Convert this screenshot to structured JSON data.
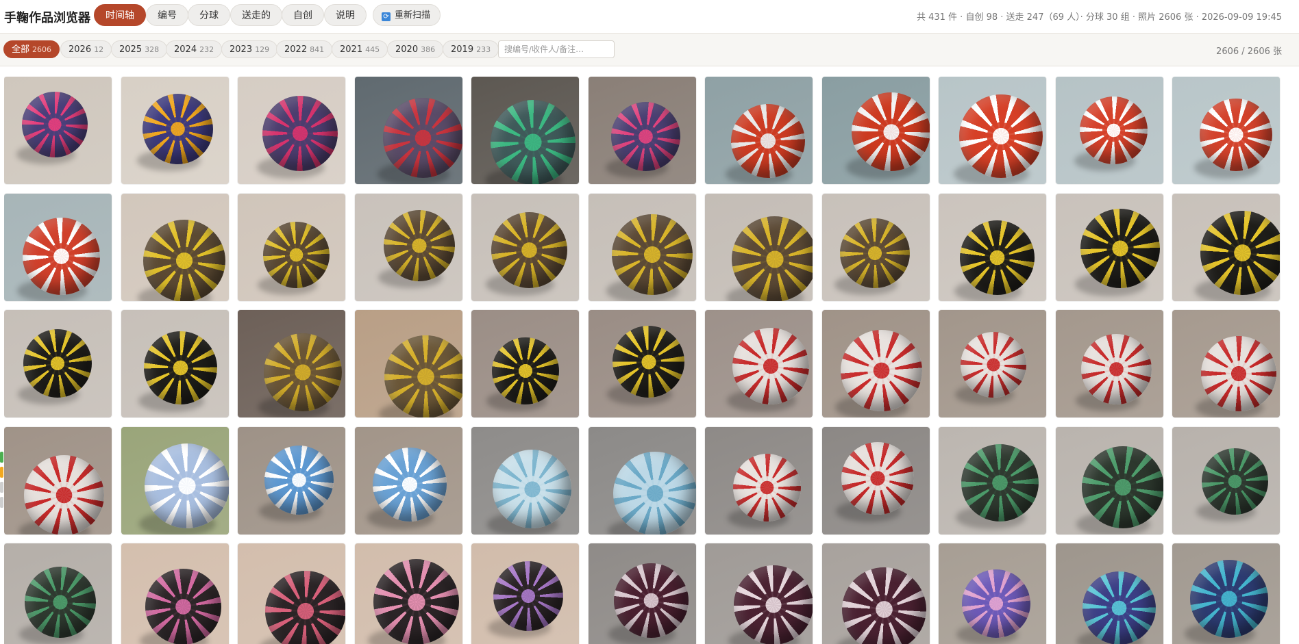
{
  "app": {
    "title": "手鞠作品浏览器",
    "tabs": [
      {
        "label": "时间轴",
        "active": true
      },
      {
        "label": "编号",
        "active": false
      },
      {
        "label": "分球",
        "active": false
      },
      {
        "label": "送走的",
        "active": false
      },
      {
        "label": "自创",
        "active": false
      },
      {
        "label": "说明",
        "active": false
      }
    ],
    "rescan_label": "重新扫描",
    "rescan_icon": "refresh-icon",
    "stats": "共 431 件 · 自创 98 · 送走 247（69 人）· 分球 30 组 · 照片 2606 张 · 2026-09-09 19:45"
  },
  "filters": {
    "years": [
      {
        "label": "全部",
        "count": "2606",
        "active": true
      },
      {
        "label": "2026",
        "count": "12",
        "active": false
      },
      {
        "label": "2025",
        "count": "328",
        "active": false
      },
      {
        "label": "2024",
        "count": "232",
        "active": false
      },
      {
        "label": "2023",
        "count": "129",
        "active": false
      },
      {
        "label": "2022",
        "count": "841",
        "active": false
      },
      {
        "label": "2021",
        "count": "445",
        "active": false
      },
      {
        "label": "2020",
        "count": "386",
        "active": false
      },
      {
        "label": "2019",
        "count": "233",
        "active": false
      }
    ],
    "search_placeholder": "搜编号/收件人/备注…",
    "search_value": "",
    "pager": "2606 / 2606 张"
  },
  "colors": {
    "accent": "#b5472a",
    "chip_bg": "#efeeec",
    "page_bg": "#ffffff"
  },
  "photos": [
    {
      "bg": "#cfc7bd",
      "ball": "#4a3f7a",
      "accent": "#e53e7c"
    },
    {
      "bg": "#d8d0c6",
      "ball": "#3d3a7e",
      "accent": "#f2a81e"
    },
    {
      "bg": "#d6cdc4",
      "ball": "#4c3d6e",
      "accent": "#d7336d"
    },
    {
      "bg": "#606a70",
      "ball": "#5a4b68",
      "accent": "#c9343e"
    },
    {
      "bg": "#5d5852",
      "ball": "#3f5a5a",
      "accent": "#3cb882"
    },
    {
      "bg": "#8a7f77",
      "ball": "#4a3f72",
      "accent": "#e0437e"
    },
    {
      "bg": "#8fa1a5",
      "ball": "#cc3b22",
      "accent": "#e9e9e9"
    },
    {
      "bg": "#8a9ea2",
      "ball": "#cc3a20",
      "accent": "#f4f4f4"
    },
    {
      "bg": "#b8c5c8",
      "ball": "#d64027",
      "accent": "#ffffff"
    },
    {
      "bg": "#b6c3c6",
      "ball": "#d5412a",
      "accent": "#ffffff"
    },
    {
      "bg": "#b9c6c9",
      "ball": "#d3422b",
      "accent": "#ffffff"
    },
    {
      "bg": "#a7b5b8",
      "ball": "#d0402b",
      "accent": "#ffffff"
    },
    {
      "bg": "#d2c7bc",
      "ball": "#5c4a33",
      "accent": "#e2c12a"
    },
    {
      "bg": "#d0c5ba",
      "ball": "#5a4832",
      "accent": "#e0be28"
    },
    {
      "bg": "#c9c2bb",
      "ball": "#5c4a35",
      "accent": "#d9b52a"
    },
    {
      "bg": "#c7c0b9",
      "ball": "#5b4834",
      "accent": "#d8b428"
    },
    {
      "bg": "#c6bfb8",
      "ball": "#5c4a36",
      "accent": "#d9b52a"
    },
    {
      "bg": "#c4bdb6",
      "ball": "#5b4935",
      "accent": "#d8b42a"
    },
    {
      "bg": "#c8c1ba",
      "ball": "#5d4b36",
      "accent": "#d9b52a"
    },
    {
      "bg": "#cbc4bd",
      "ball": "#1f1e1a",
      "accent": "#e6c52a"
    },
    {
      "bg": "#c9c2bb",
      "ball": "#1f1e1a",
      "accent": "#e6c52a"
    },
    {
      "bg": "#c8c1ba",
      "ball": "#1f1e1a",
      "accent": "#e6c52a"
    },
    {
      "bg": "#c6bfb8",
      "ball": "#1f1e1a",
      "accent": "#e6c52a"
    },
    {
      "bg": "#c7c0b9",
      "ball": "#1f1e1a",
      "accent": "#e6c52a"
    },
    {
      "bg": "#6d6058",
      "ball": "#6a5535",
      "accent": "#d3ad2a"
    },
    {
      "bg": "#b99f86",
      "ball": "#6b5738",
      "accent": "#d6b02c"
    },
    {
      "bg": "#9b8e86",
      "ball": "#1f1e1a",
      "accent": "#e6c52a"
    },
    {
      "bg": "#9a8d85",
      "ball": "#1f1e1a",
      "accent": "#e6c52a"
    },
    {
      "bg": "#9d918a",
      "ball": "#e6e0dc",
      "accent": "#c72a2a"
    },
    {
      "bg": "#a09388",
      "ball": "#e8e2de",
      "accent": "#c92c2c"
    },
    {
      "bg": "#a2968b",
      "ball": "#e8e2de",
      "accent": "#c92c2c"
    },
    {
      "bg": "#a4988d",
      "ball": "#e6e0dc",
      "accent": "#c72a2a"
    },
    {
      "bg": "#a69a8f",
      "ball": "#e6e0dc",
      "accent": "#c72a2a"
    },
    {
      "bg": "#a09388",
      "ball": "#e6e0dc",
      "accent": "#c72a2a"
    },
    {
      "bg": "#9aa57a",
      "ball": "#a9bfe0",
      "accent": "#ffffff"
    },
    {
      "bg": "#9e9287",
      "ball": "#5d98d1",
      "accent": "#ffffff"
    },
    {
      "bg": "#a29589",
      "ball": "#6aa2d5",
      "accent": "#ffffff"
    },
    {
      "bg": "#8e8c8a",
      "ball": "#c9e0ea",
      "accent": "#7eb6cf"
    },
    {
      "bg": "#8c8a88",
      "ball": "#bcd8e6",
      "accent": "#6ba9c7"
    },
    {
      "bg": "#8e8a87",
      "ball": "#e8e2de",
      "accent": "#c92c2c"
    },
    {
      "bg": "#8c8885",
      "ball": "#e6e0dc",
      "accent": "#c72a2a"
    },
    {
      "bg": "#bcb6b0",
      "ball": "#2f3a30",
      "accent": "#4c9b6a"
    },
    {
      "bg": "#bab4ae",
      "ball": "#2d382e",
      "accent": "#4e9d6c"
    },
    {
      "bg": "#b8b2ac",
      "ball": "#2e3930",
      "accent": "#4b9a69"
    },
    {
      "bg": "#b5afa9",
      "ball": "#2f3a30",
      "accent": "#4c9b6a"
    },
    {
      "bg": "#d4bfae",
      "ball": "#2d2628",
      "accent": "#d46aa2"
    },
    {
      "bg": "#d3bead",
      "ball": "#2b2426",
      "accent": "#d8607a"
    },
    {
      "bg": "#d2bdac",
      "ball": "#2c2527",
      "accent": "#e48fb0"
    },
    {
      "bg": "#d1bcab",
      "ball": "#2b2426",
      "accent": "#a878c8"
    },
    {
      "bg": "#8f8b88",
      "ball": "#4a2030",
      "accent": "#d9c8cf"
    },
    {
      "bg": "#a09b97",
      "ball": "#4b2232",
      "accent": "#e6d6dc"
    },
    {
      "bg": "#a8a29d",
      "ball": "#4a2131",
      "accent": "#e2d2d8"
    },
    {
      "bg": "#a79e94",
      "ball": "#6d5ab8",
      "accent": "#e2a3d0"
    },
    {
      "bg": "#9e968d",
      "ball": "#3c3f86",
      "accent": "#58c5d6"
    },
    {
      "bg": "#a29a91",
      "ball": "#2d3c72",
      "accent": "#45b6cf"
    }
  ]
}
